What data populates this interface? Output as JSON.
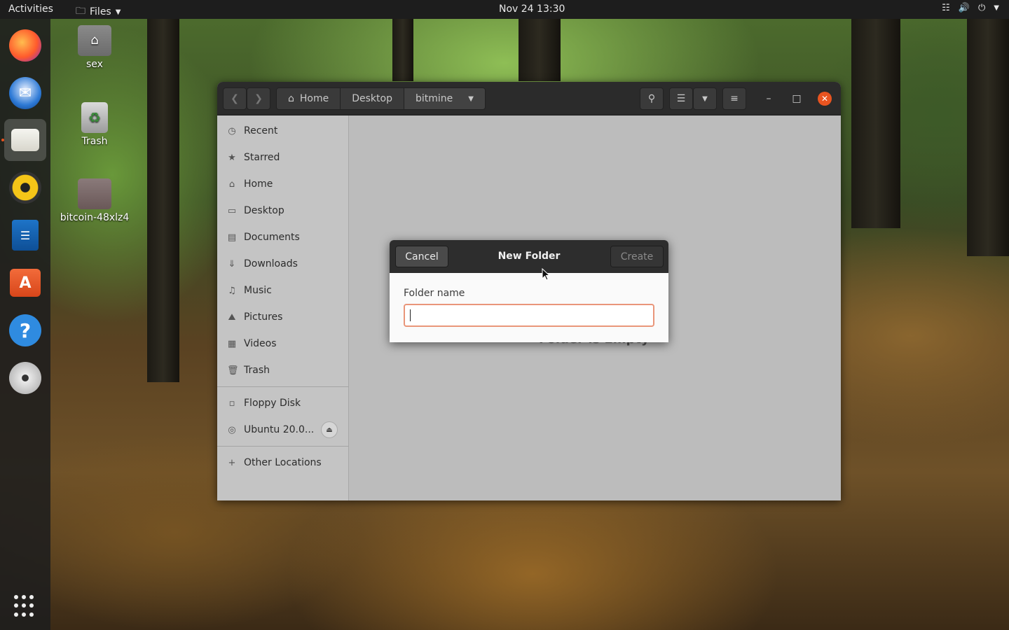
{
  "topbar": {
    "activities": "Activities",
    "app_menu": "Files",
    "clock": "Nov 24  13:30"
  },
  "dock": {
    "items": [
      "firefox",
      "thunderbird",
      "files",
      "rhythmbox",
      "libreoffice-writer",
      "ubuntu-software",
      "help",
      "dvd"
    ],
    "active": "files"
  },
  "desktop": {
    "icons": [
      {
        "label": "sex"
      },
      {
        "label": "Trash"
      },
      {
        "label": "bitcoin-48xlz4"
      }
    ]
  },
  "files_window": {
    "breadcrumbs": [
      "Home",
      "Desktop",
      "bitmine"
    ],
    "sidebar": {
      "places": [
        "Recent",
        "Starred",
        "Home",
        "Desktop",
        "Documents",
        "Downloads",
        "Music",
        "Pictures",
        "Videos",
        "Trash"
      ],
      "devices": [
        "Floppy Disk",
        "Ubuntu 20.0..."
      ],
      "other": "Other Locations"
    },
    "empty_message": "Folder is Empty"
  },
  "dialog": {
    "cancel": "Cancel",
    "title": "New Folder",
    "create": "Create",
    "field_label": "Folder name",
    "field_value": ""
  },
  "colors": {
    "accent": "#e95420",
    "topbar": "#1d1d1d",
    "headerbar": "#2b2b2b"
  }
}
